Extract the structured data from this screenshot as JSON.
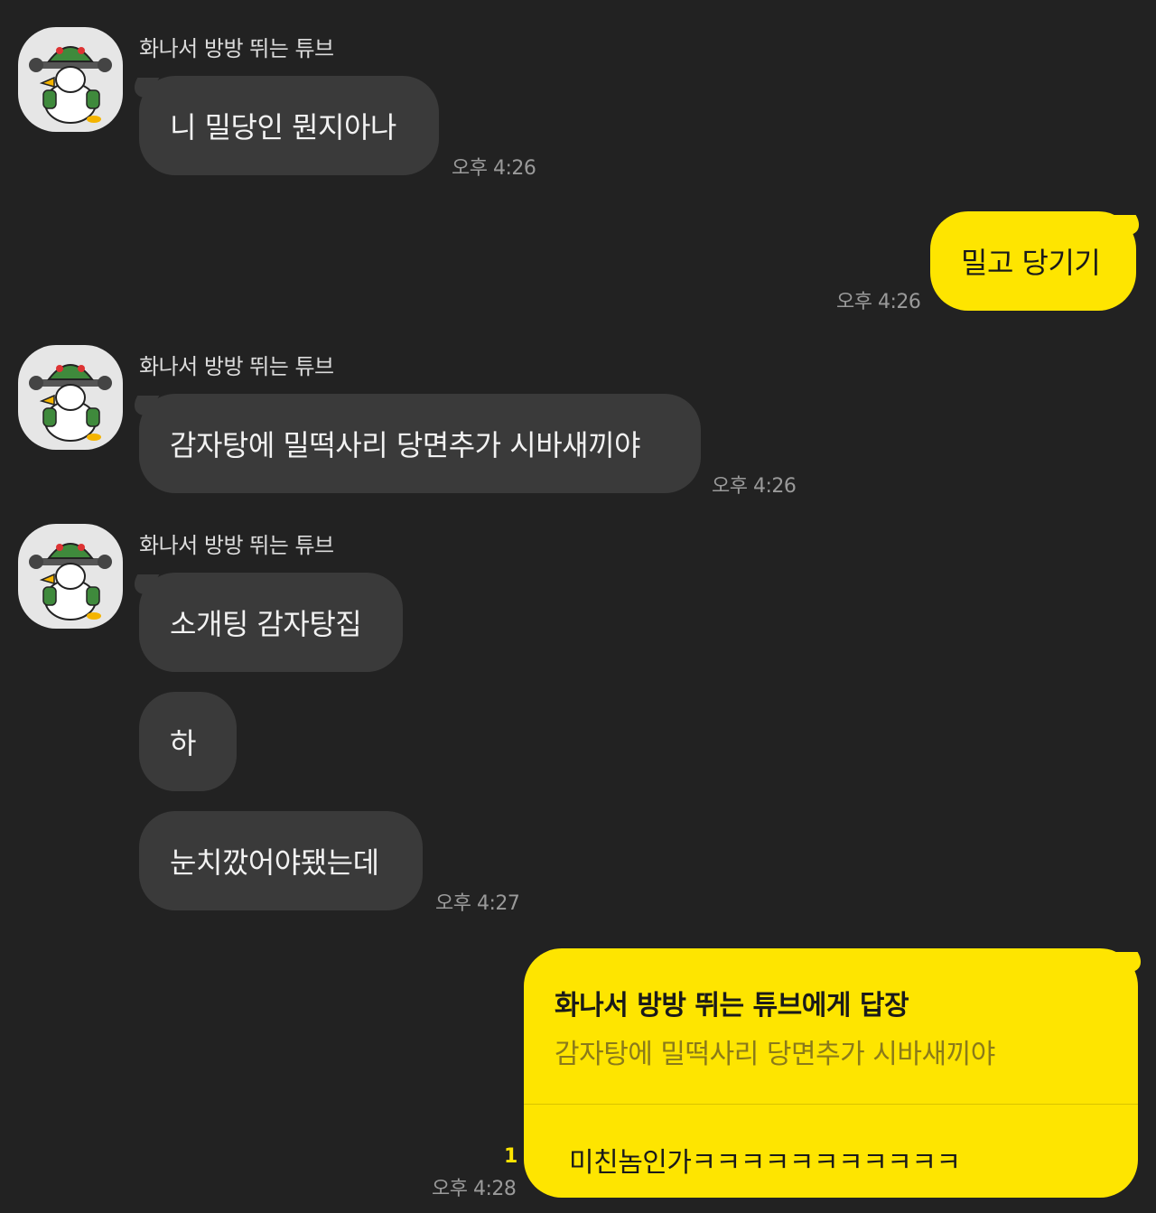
{
  "colors": {
    "background": "#222222",
    "incoming_bubble": "#3a3a3a",
    "outgoing_bubble": "#fee500",
    "time_text": "#9a9a9a",
    "unread_count": "#fee500"
  },
  "messages": [
    {
      "sender": "화나서 방방 뛰는 튜브",
      "text": "니 밀당인 뭔지아나",
      "time": "오후 4:26"
    },
    {
      "text": "밀고 당기기",
      "time": "오후 4:26"
    },
    {
      "sender": "화나서 방방 뛰는 튜브",
      "text": "감자탕에 밀떡사리 당면추가 시바새끼야",
      "time": "오후 4:26"
    },
    {
      "sender": "화나서 방방 뛰는 튜브",
      "text": "소개팅 감자탕집"
    },
    {
      "text": "하"
    },
    {
      "text": "눈치깠어야됐는데",
      "time": "오후 4:27"
    }
  ],
  "reply": {
    "to_label": "화나서 방방 뛰는 튜브에게 답장",
    "quote": "감자탕에 밀떡사리 당면추가 시바새끼야",
    "text": "미친놈인가ㅋㅋㅋㅋㅋㅋㅋㅋㅋㅋㅋ",
    "unread": "1",
    "time": "오후 4:28"
  },
  "avatar_icon": "angry-duck-avatar-icon"
}
